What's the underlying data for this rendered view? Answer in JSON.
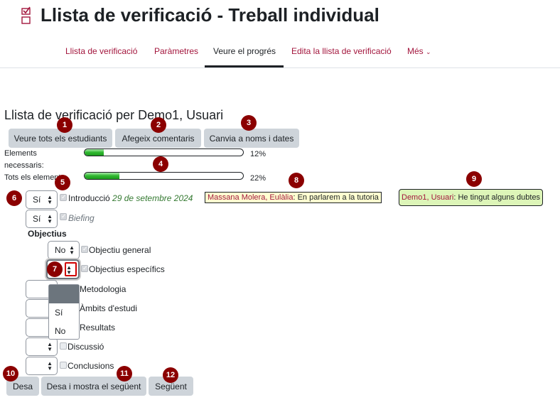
{
  "header": {
    "title": "Llista de verificació - Treball individual",
    "icon": "checklist-icon",
    "accent_color": "#a3163d"
  },
  "nav": {
    "items": [
      {
        "label": "Llista de verificació",
        "active": false
      },
      {
        "label": "Paràmetres",
        "active": false
      },
      {
        "label": "Veure el progrés",
        "active": true
      },
      {
        "label": "Edita la llista de verificació",
        "active": false
      },
      {
        "label": "Més",
        "active": false
      }
    ]
  },
  "section_title": "Llista de verificació per Demo1, Usuari",
  "toolbar": {
    "view_all_label": "Veure tots els estudiants",
    "add_comments_label": "Afegeix comentaris",
    "toggle_names_label": "Canvia a noms i dates"
  },
  "progress": {
    "required_label": "Elements necessaris:",
    "required_percent": "12%",
    "required_fraction": 0.12,
    "all_label": "Tots els elements:",
    "all_percent": "22%",
    "all_fraction": 0.22
  },
  "items": [
    {
      "value": "Sí",
      "checked": true,
      "label": "Introducció",
      "date": "29 de setembre 2024",
      "italic": false
    },
    {
      "value": "Sí",
      "checked": true,
      "label": "Biefing",
      "italic": true
    },
    {
      "value": "No",
      "checked": true,
      "label": "Objectiu general",
      "italic": false
    },
    {
      "value": "",
      "checked": true,
      "label": "Objectius específics",
      "italic": false
    },
    {
      "value": "",
      "checked": false,
      "label": "Metodologia",
      "italic": false
    },
    {
      "value": "",
      "checked": false,
      "label": "Àmbits d'estudi",
      "italic": false
    },
    {
      "value": "",
      "checked": false,
      "label": "Resultats",
      "italic": false
    },
    {
      "value": "",
      "checked": false,
      "label": "Discussió",
      "italic": false
    },
    {
      "value": "",
      "checked": false,
      "label": "Conclusions",
      "italic": false
    }
  ],
  "subgroup_label": "Objectius",
  "comments": {
    "teacher": {
      "name": "Massana Molera, Eulàlia",
      "sep": ":",
      "text": " En parlarem a la tutoria"
    },
    "student": {
      "name": "Demo1, Usuari",
      "sep": ":",
      "text": " He tingut alguns dubtes"
    }
  },
  "dropdown_options": [
    "",
    "Sí",
    "No"
  ],
  "footer": {
    "save_label": "Desa",
    "save_next_label": "Desa i mostra el següent",
    "next_label": "Següent"
  },
  "badges": [
    "1",
    "2",
    "3",
    "4",
    "5",
    "6",
    "7",
    "8",
    "9",
    "10",
    "11",
    "12"
  ],
  "badge_color": "#8b0000"
}
